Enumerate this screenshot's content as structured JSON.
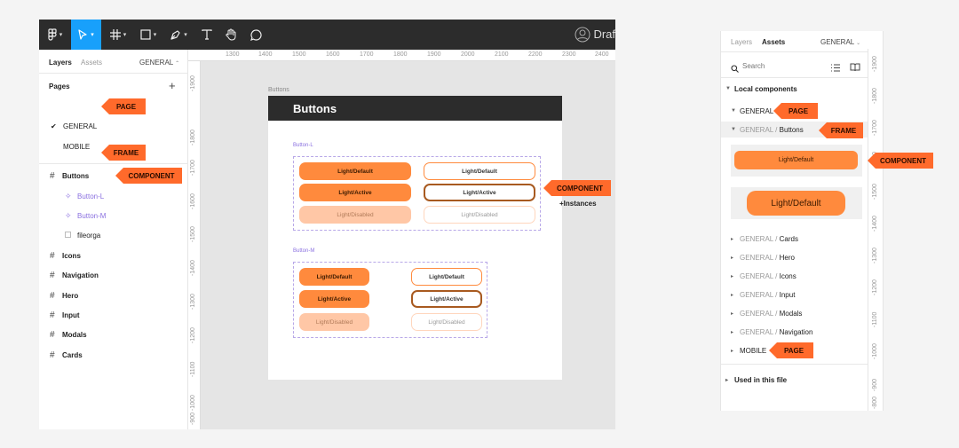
{
  "toolbar": {
    "draft_label": "Draf"
  },
  "left_panel": {
    "tabs": [
      "Layers",
      "Assets"
    ],
    "page_selector": "GENERAL",
    "pages_title": "Pages",
    "pages": [
      "GENERAL",
      "MOBILE"
    ],
    "layers": {
      "frame": "Buttons",
      "children": [
        "Button-L",
        "Button-M",
        "fileorga"
      ],
      "frames": [
        "Icons",
        "Navigation",
        "Hero",
        "Input",
        "Modals",
        "Cards"
      ]
    }
  },
  "canvas": {
    "ruler_h": [
      "1300",
      "1400",
      "1500",
      "1600",
      "1700",
      "1800",
      "1900",
      "2000",
      "2100",
      "2200",
      "2300",
      "2400"
    ],
    "ruler_v": [
      "-1900",
      "-1800",
      "-1700",
      "-1600",
      "-1500",
      "-1400",
      "-1300",
      "-1200",
      "-1100",
      "-1000",
      "-900"
    ],
    "frame_label": "Buttons",
    "frame_title": "Buttons",
    "group_l_label": "Button-L",
    "group_m_label": "Button-M",
    "btn_default": "Light/Default",
    "btn_active": "Light/Active",
    "btn_disabled": "Light/Disabled"
  },
  "right_panel": {
    "tabs": [
      "Layers",
      "Assets"
    ],
    "page_selector": "GENERAL",
    "search_placeholder": "Search",
    "local_components": "Local components",
    "general": "GENERAL",
    "general_prefix": "GENERAL /",
    "buttons": "Buttons",
    "preview_small": "Light/Default",
    "preview_large": "Light/Default",
    "groups": [
      "Cards",
      "Hero",
      "Icons",
      "Input",
      "Modals",
      "Navigation"
    ],
    "mobile": "MOBILE",
    "used_in_file": "Used in this file",
    "ruler_v": [
      "-1900",
      "-1800",
      "-1700",
      "-1600",
      "-1500",
      "-1400",
      "-1300",
      "-1200",
      "-1100",
      "-1000",
      "-900",
      "-800"
    ]
  },
  "tags": {
    "page": "PAGE",
    "frame": "FRAME",
    "component": "COMPONENT",
    "instances": "+Instances"
  },
  "colors": {
    "accent_orange": "#ff8a3d",
    "tag_orange": "#ff6a2b",
    "toolbar_dark": "#2c2c2c",
    "active_tool_blue": "#18a0fb",
    "component_purple": "#8a70e0"
  }
}
